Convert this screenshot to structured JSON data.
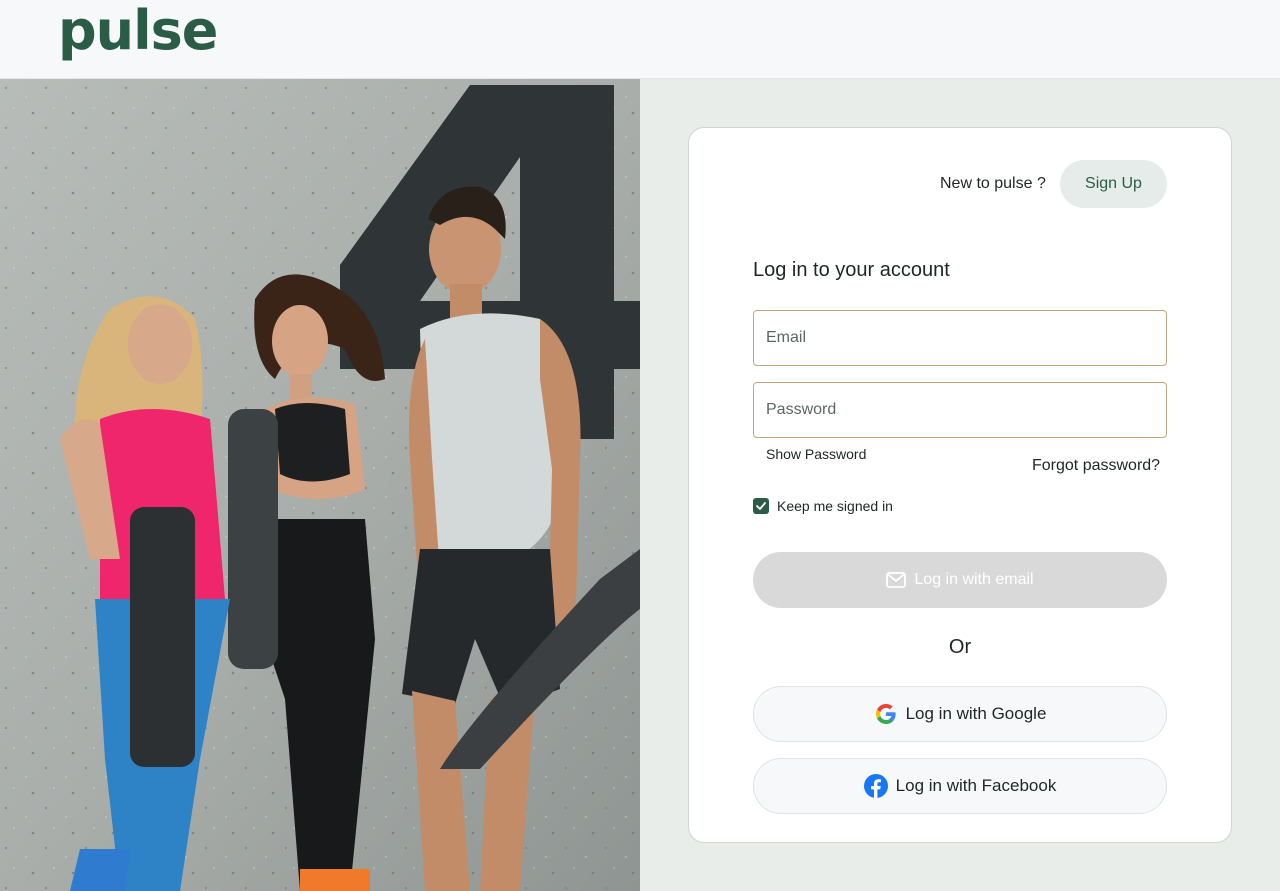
{
  "brand": {
    "logo_text": "pulse",
    "color": "#2b5c45"
  },
  "hero": {
    "image": "fitness-group-photo"
  },
  "signup_prompt": {
    "text": "New to pulse ?",
    "button_label": "Sign Up"
  },
  "login": {
    "heading": "Log in to your account",
    "email": {
      "placeholder": "Email",
      "value": ""
    },
    "password": {
      "placeholder": "Password",
      "value": ""
    },
    "show_password_label": "Show Password",
    "forgot_password_label": "Forgot password?",
    "keep_signed_in": {
      "label": "Keep me signed in",
      "checked": true
    },
    "email_button_label": "Log in with email",
    "divider_text": "Or",
    "google_button_label": "Log in with Google",
    "facebook_button_label": "Log in with Facebook"
  },
  "colors": {
    "accent": "#2b5c45",
    "page_background": "#e8edea",
    "disabled_button": "#d9d9d9",
    "input_border": "#c5a580",
    "facebook_blue": "#1877f2"
  }
}
